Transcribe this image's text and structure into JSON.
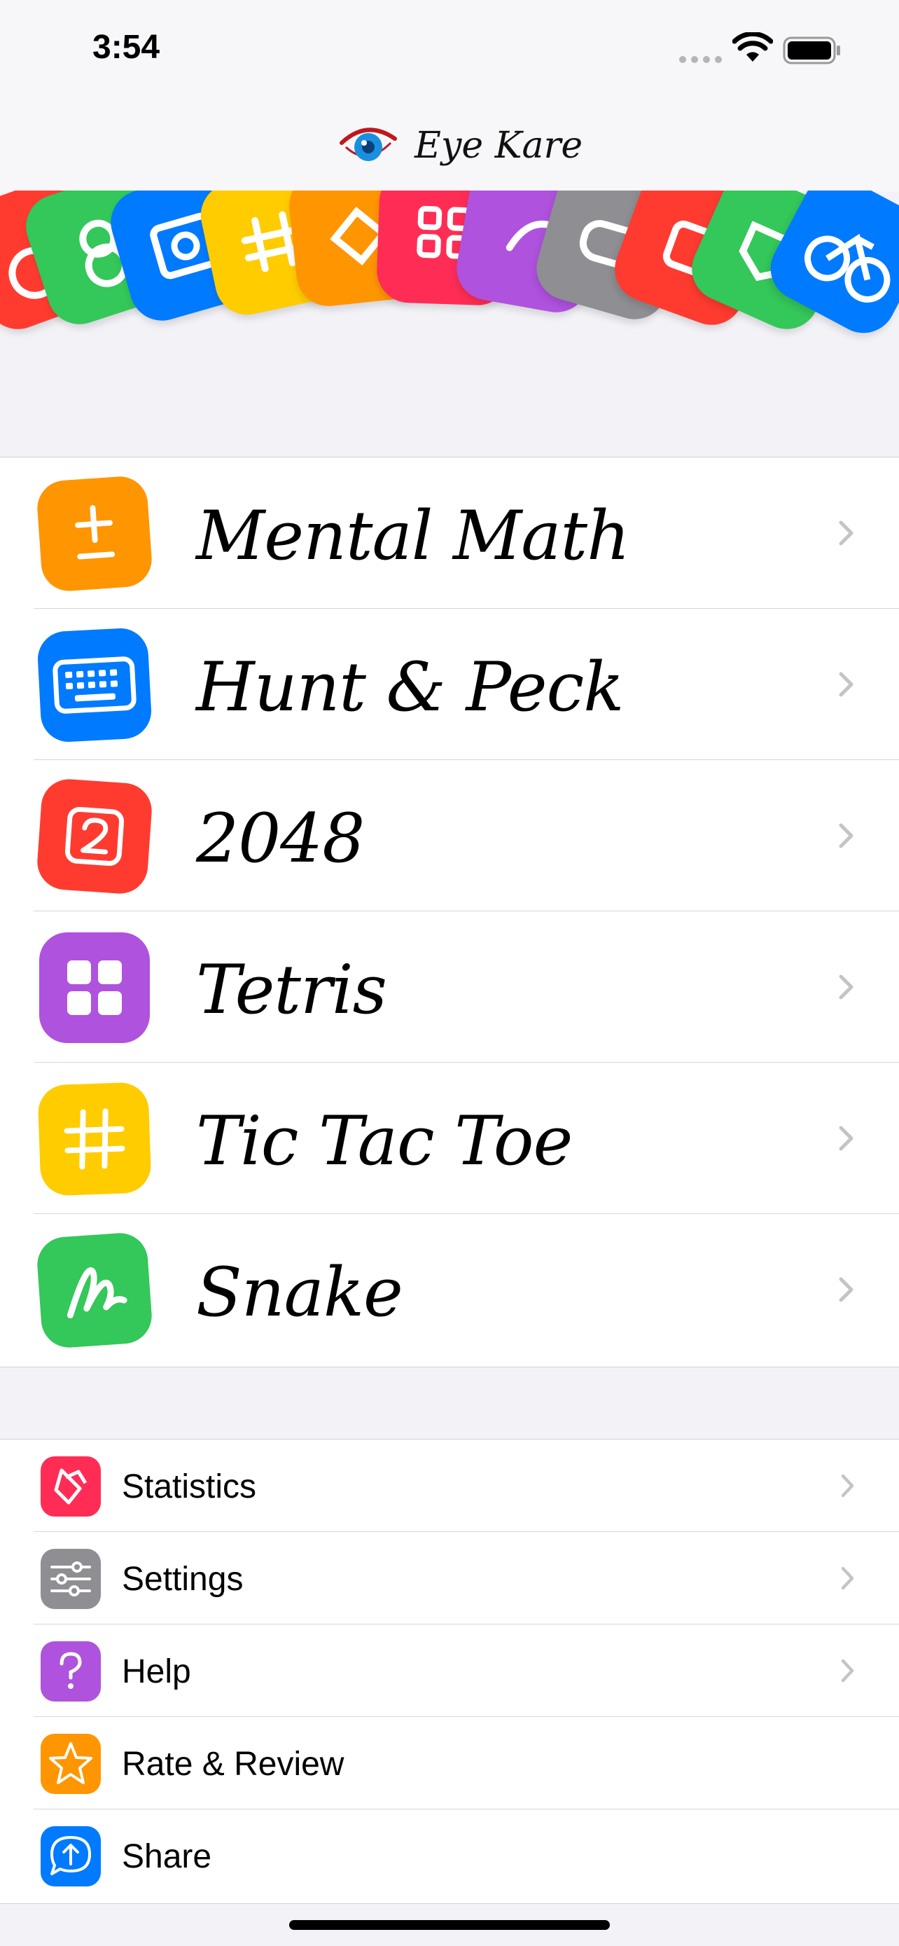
{
  "status_bar": {
    "time": "3:54"
  },
  "nav": {
    "title": "Eye Kare"
  },
  "games": [
    {
      "label": "Mental Math",
      "color": "#ff9500",
      "icon": "plus-minus-icon"
    },
    {
      "label": "Hunt & Peck",
      "color": "#007aff",
      "icon": "keyboard-icon"
    },
    {
      "label": "2048",
      "color": "#ff3b30",
      "icon": "number-2-square-icon"
    },
    {
      "label": "Tetris",
      "color": "#af52de",
      "icon": "grid-squares-icon"
    },
    {
      "label": "Tic Tac Toe",
      "color": "#ffcc00",
      "icon": "hash-grid-icon"
    },
    {
      "label": "Snake",
      "color": "#34c759",
      "icon": "scribble-icon"
    }
  ],
  "menu": [
    {
      "label": "Statistics",
      "color": "#ff2d55",
      "icon": "stats-icon"
    },
    {
      "label": "Settings",
      "color": "#8e8e93",
      "icon": "sliders-icon"
    },
    {
      "label": "Help",
      "color": "#af52de",
      "icon": "question-mark-icon"
    },
    {
      "label": "Rate & Review",
      "color": "#ff9500",
      "icon": "star-icon"
    },
    {
      "label": "Share",
      "color": "#007aff",
      "icon": "share-bubble-icon"
    }
  ]
}
